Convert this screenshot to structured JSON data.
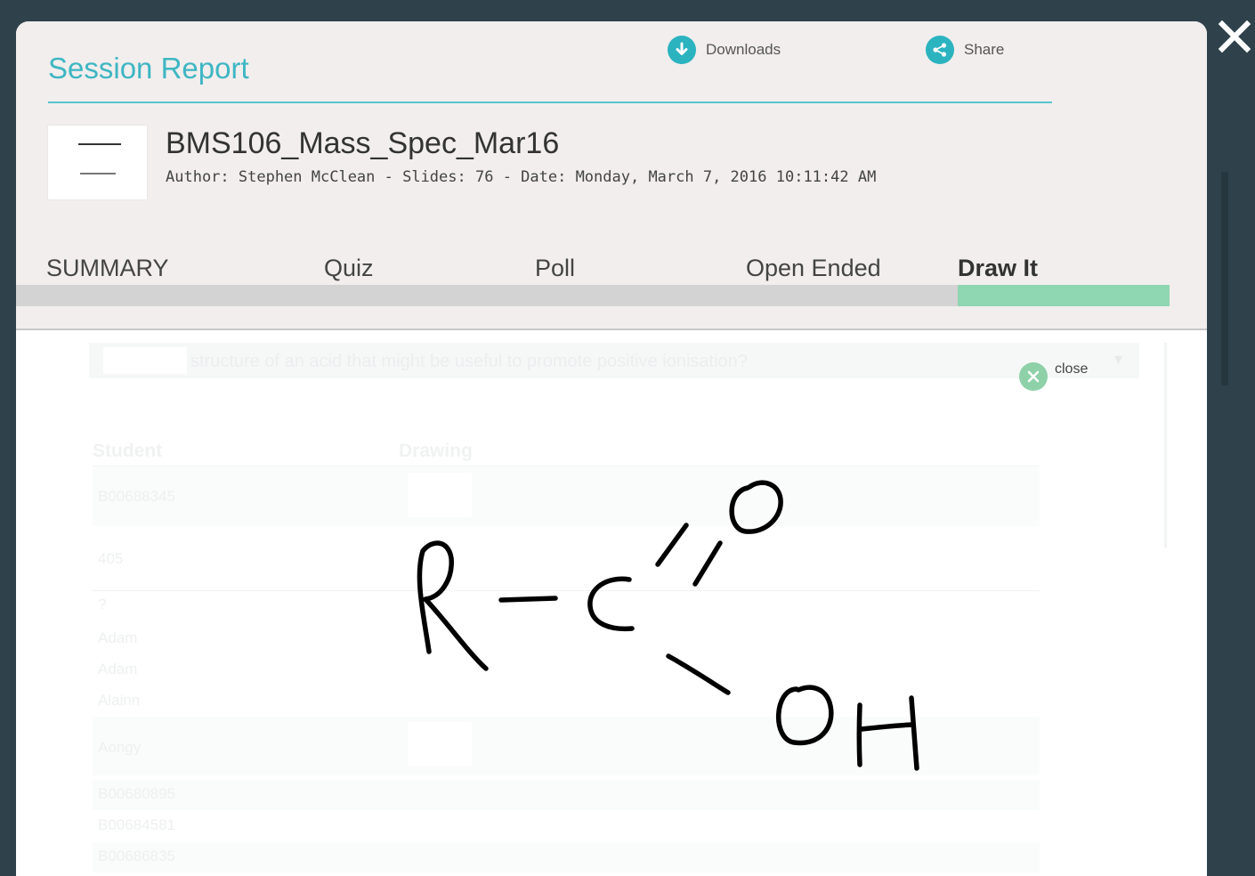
{
  "modal": {
    "title": "Session Report",
    "actions": {
      "downloads_label": "Downloads",
      "share_label": "Share"
    }
  },
  "session": {
    "name": "BMS106_Mass_Spec_Mar16",
    "meta": "Author: Stephen McClean - Slides: 76 - Date: Monday, March 7, 2016 10:11:42 AM"
  },
  "tabs": [
    {
      "label": "SUMMARY"
    },
    {
      "label": "Quiz"
    },
    {
      "label": "Poll"
    },
    {
      "label": "Open Ended"
    },
    {
      "label": "Draw It",
      "active": true
    }
  ],
  "question": {
    "text": "structure of an acid that might be useful to promote positive ionisation?"
  },
  "overlay": {
    "close_label": "close"
  },
  "table": {
    "headers": [
      "Student",
      "Drawing"
    ],
    "rows": [
      "B00688345",
      "405",
      "?",
      "Adam",
      "Adam",
      "Alainn",
      "Aongy",
      "B00680895",
      "B00684581",
      "B00686835"
    ]
  },
  "colors": {
    "accent": "#3eb6c3",
    "active_tab": "#8fd6b2",
    "backdrop": "#2f424c"
  }
}
